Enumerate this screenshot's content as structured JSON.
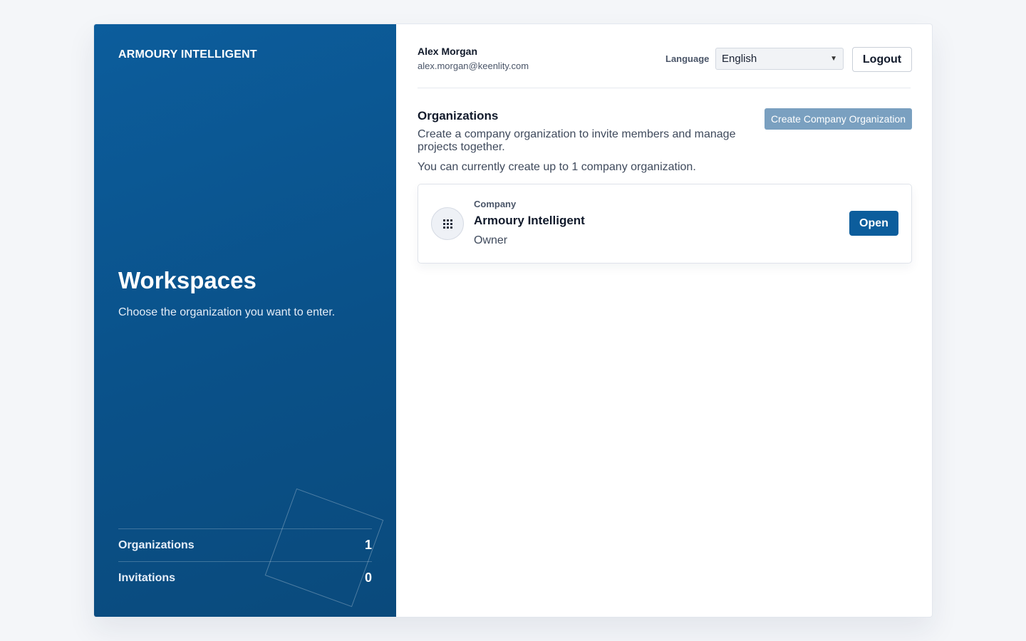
{
  "sidebar": {
    "brand": "ARMOURY INTELLIGENT",
    "title": "Workspaces",
    "subtitle": "Choose the organization you want to enter.",
    "stats": [
      {
        "label": "Organizations",
        "value": "1"
      },
      {
        "label": "Invitations",
        "value": "0"
      }
    ]
  },
  "header": {
    "user_name": "Alex Morgan",
    "user_email": "alex.morgan@keenlity.com",
    "language_label": "Language",
    "language_value": "English",
    "logout_label": "Logout"
  },
  "organizations": {
    "title": "Organizations",
    "description": "Create a company organization to invite members and manage projects together.",
    "limit_text": "You can currently create up to 1 company organization.",
    "create_button": "Create Company Organization",
    "items": [
      {
        "type": "Company",
        "name": "Armoury Intelligent",
        "role": "Owner",
        "icon": "grid-icon",
        "open_label": "Open"
      }
    ]
  },
  "colors": {
    "brand_blue": "#0c5d9c",
    "create_button_bg": "#7aa0c0"
  }
}
